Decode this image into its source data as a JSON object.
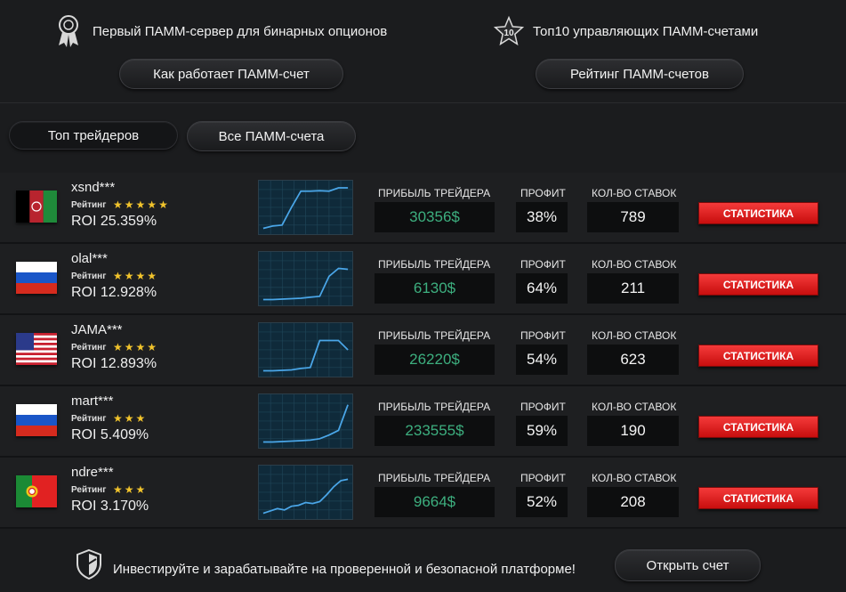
{
  "header": {
    "left_promo": "Первый ПАММ-сервер для бинарных опционов",
    "right_promo": "Топ10 управляющих ПАММ-счетами",
    "right_badge": "10",
    "how_button": "Как работает ПАММ-счет",
    "rating_button": "Рейтинг ПАММ-счетов"
  },
  "tabs": {
    "top_traders": "Топ трейдеров",
    "all_accounts": "Все ПАММ-счета"
  },
  "labels": {
    "rating": "Рейтинг",
    "trader_profit": "ПРИБЫЛЬ ТРЕЙДЕРА",
    "profit_pct": "ПРОФИТ",
    "bets_count": "КОЛ-ВО СТАВОК",
    "stats_button": "СТАТИСТИКА"
  },
  "traders": [
    {
      "name": "xsnd***",
      "flag": "afghanistan",
      "stars": 5,
      "roi": "ROI 25.359%",
      "profit": "30356$",
      "pct": "38%",
      "bets": "789",
      "spark": [
        0.05,
        0.1,
        0.12,
        0.5,
        0.85,
        0.85,
        0.86,
        0.85,
        0.92,
        0.92
      ]
    },
    {
      "name": "olal***",
      "flag": "russia",
      "stars": 4,
      "roi": "ROI 12.928%",
      "profit": "6130$",
      "pct": "64%",
      "bets": "211",
      "spark": [
        0.05,
        0.05,
        0.06,
        0.07,
        0.08,
        0.1,
        0.12,
        0.55,
        0.72,
        0.7
      ]
    },
    {
      "name": "JAMA***",
      "flag": "usa",
      "stars": 4,
      "roi": "ROI 12.893%",
      "profit": "26220$",
      "pct": "54%",
      "bets": "623",
      "spark": [
        0.05,
        0.05,
        0.06,
        0.07,
        0.1,
        0.12,
        0.7,
        0.7,
        0.7,
        0.5
      ]
    },
    {
      "name": "mart***",
      "flag": "russia",
      "stars": 3,
      "roi": "ROI 5.409%",
      "profit": "233555$",
      "pct": "59%",
      "bets": "190",
      "spark": [
        0.05,
        0.05,
        0.06,
        0.07,
        0.08,
        0.09,
        0.12,
        0.2,
        0.3,
        0.85
      ]
    },
    {
      "name": "ndre***",
      "flag": "portugal",
      "stars": 3,
      "roi": "ROI 3.170%",
      "profit": "9664$",
      "pct": "52%",
      "bets": "208",
      "spark": [
        0.05,
        0.1,
        0.15,
        0.12,
        0.2,
        0.22,
        0.28,
        0.26,
        0.3,
        0.45,
        0.62,
        0.75,
        0.78
      ]
    }
  ],
  "footer": {
    "text": "Инвестируйте и зарабатывайте на проверенной и безопасной платформе!",
    "open_button": "Открыть счет"
  },
  "colors": {
    "background": "#1b1c1e",
    "profit_text": "#3daf7f",
    "stat_button": "#e02121",
    "stars": "#f2c42c",
    "spark_line": "#4aa6e8"
  },
  "icons": {
    "left_promo": "medal-icon",
    "right_promo": "star-badge-icon",
    "footer": "shield-icon"
  }
}
